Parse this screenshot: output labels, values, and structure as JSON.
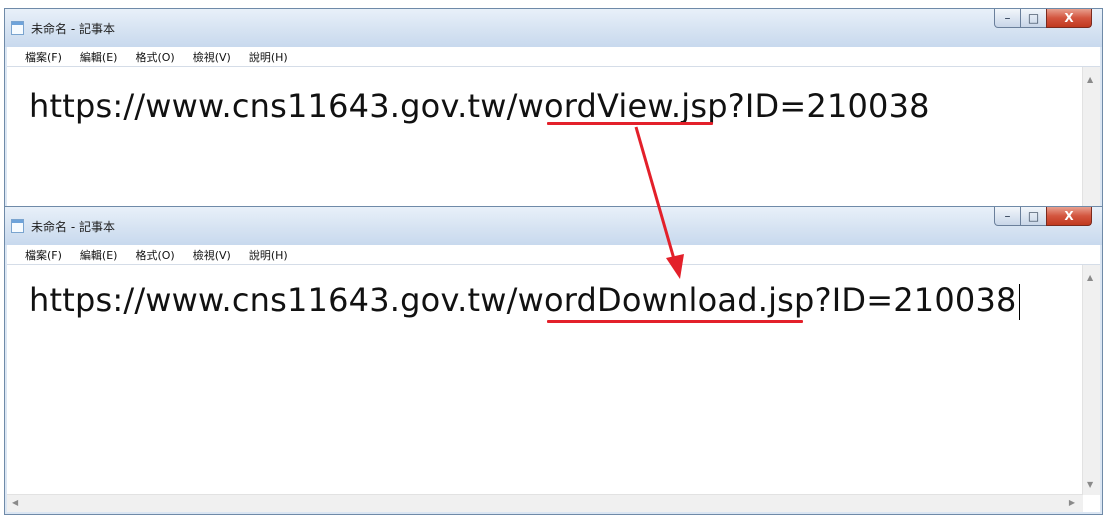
{
  "window1": {
    "title": "未命名 - 記事本",
    "menu": [
      "檔案(F)",
      "編輯(E)",
      "格式(O)",
      "檢視(V)",
      "說明(H)"
    ],
    "text_prefix": "https://www.cns11643.gov.tw/",
    "text_highlight": "wordView",
    "text_suffix": ".jsp?ID=210038"
  },
  "window2": {
    "title": "未命名 - 記事本",
    "menu": [
      "檔案(F)",
      "編輯(E)",
      "格式(O)",
      "檢視(V)",
      "說明(H)"
    ],
    "text_prefix": "https://www.cns11643.gov.tw/",
    "text_highlight": "wordDownload",
    "text_suffix": ".jsp?ID=210038"
  },
  "caption_buttons": {
    "minimize": "–",
    "maximize": "□",
    "close": "X"
  },
  "scroll_arrows": {
    "up": "▲",
    "down": "▼",
    "left": "◀",
    "right": "▶"
  },
  "colors": {
    "annotation": "#e3202a",
    "close_button": "#c8452f"
  },
  "icons": {
    "app": "notepad-icon"
  }
}
